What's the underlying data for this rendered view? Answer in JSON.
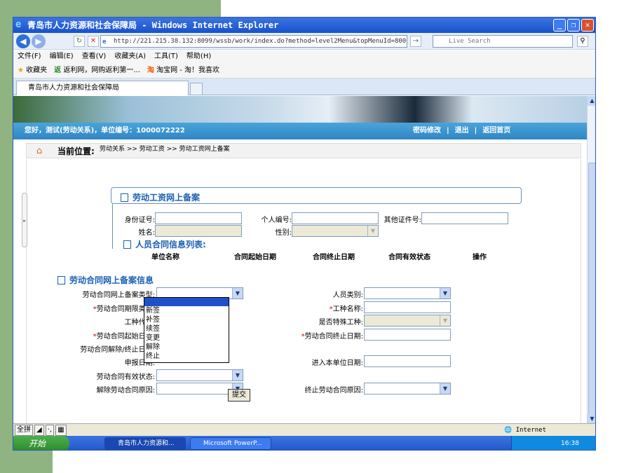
{
  "window": {
    "title": "青岛市人力资源和社会保障局 - Windows Internet Explorer",
    "url": "http://221.215.38.132:8099/wssb/work/index.do?method=level2Menu&topMenuId=8000",
    "search_placeholder": "Live Search"
  },
  "menu": [
    "文件(F)",
    "编辑(E)",
    "查看(V)",
    "收藏夹(A)",
    "工具(T)",
    "帮助(H)"
  ],
  "favorites": [
    "收藏夹",
    "返利网，网购返利第一...",
    "淘宝网 - 淘！我喜欢"
  ],
  "tab_title": "青岛市人力资源和社会保障局",
  "header": {
    "greeting": "您好，测试(劳动关系)，单位编号：1000072222",
    "links": [
      "密码修改",
      "|",
      "退出",
      "|",
      "返回首页"
    ]
  },
  "breadcrumb": {
    "label": "当前位置:",
    "path": "劳动关系 >> 劳动工资 >> 劳动工资网上备案"
  },
  "section1": {
    "title": "劳动工资网上备案",
    "id_label": "身份证号:",
    "person_no_label": "个人编号:",
    "other_id_label": "其他证件号:",
    "name_label": "姓名:",
    "gender_label": "性别:"
  },
  "contract_list": {
    "title": "人员合同信息列表:",
    "columns": [
      "单位名称",
      "合同起始日期",
      "合同终止日期",
      "合同有效状态",
      "操作"
    ]
  },
  "section2": {
    "title": "劳动合同网上备案信息",
    "filing_type_label": "劳动合同网上备案类型:",
    "person_type_label": "人员类别:",
    "term_type_label": "劳动合同期限类型:",
    "job_name_label": "工种名称:",
    "job_code_label": "工种代码:",
    "special_job_label": "是否特殊工种:",
    "start_date_label": "劳动合同起始日期:",
    "end_date_label": "劳动合同终止日期:",
    "terminate_date_label": "劳动合同解除/终止日期:",
    "apply_date_label": "申报日期:",
    "join_date_label": "进入本单位日期:",
    "valid_status_label": "劳动合同有效状态:",
    "dissolve_reason_label": "解除劳动合同原因:",
    "end_reason_label": "终止劳动合同原因:",
    "required_mark": "*",
    "submit": "提交"
  },
  "dropdown_options": [
    "",
    "新签",
    "补签",
    "续签",
    "变更",
    "解除",
    "终止"
  ],
  "status": {
    "ime": [
      "全拼",
      "◢",
      "·,",
      "▦"
    ],
    "zone": "Internet"
  },
  "taskbar": {
    "start": "开始",
    "items": [
      "青岛市人力资源和...",
      "Microsoft PowerP..."
    ],
    "time": "16:38"
  }
}
